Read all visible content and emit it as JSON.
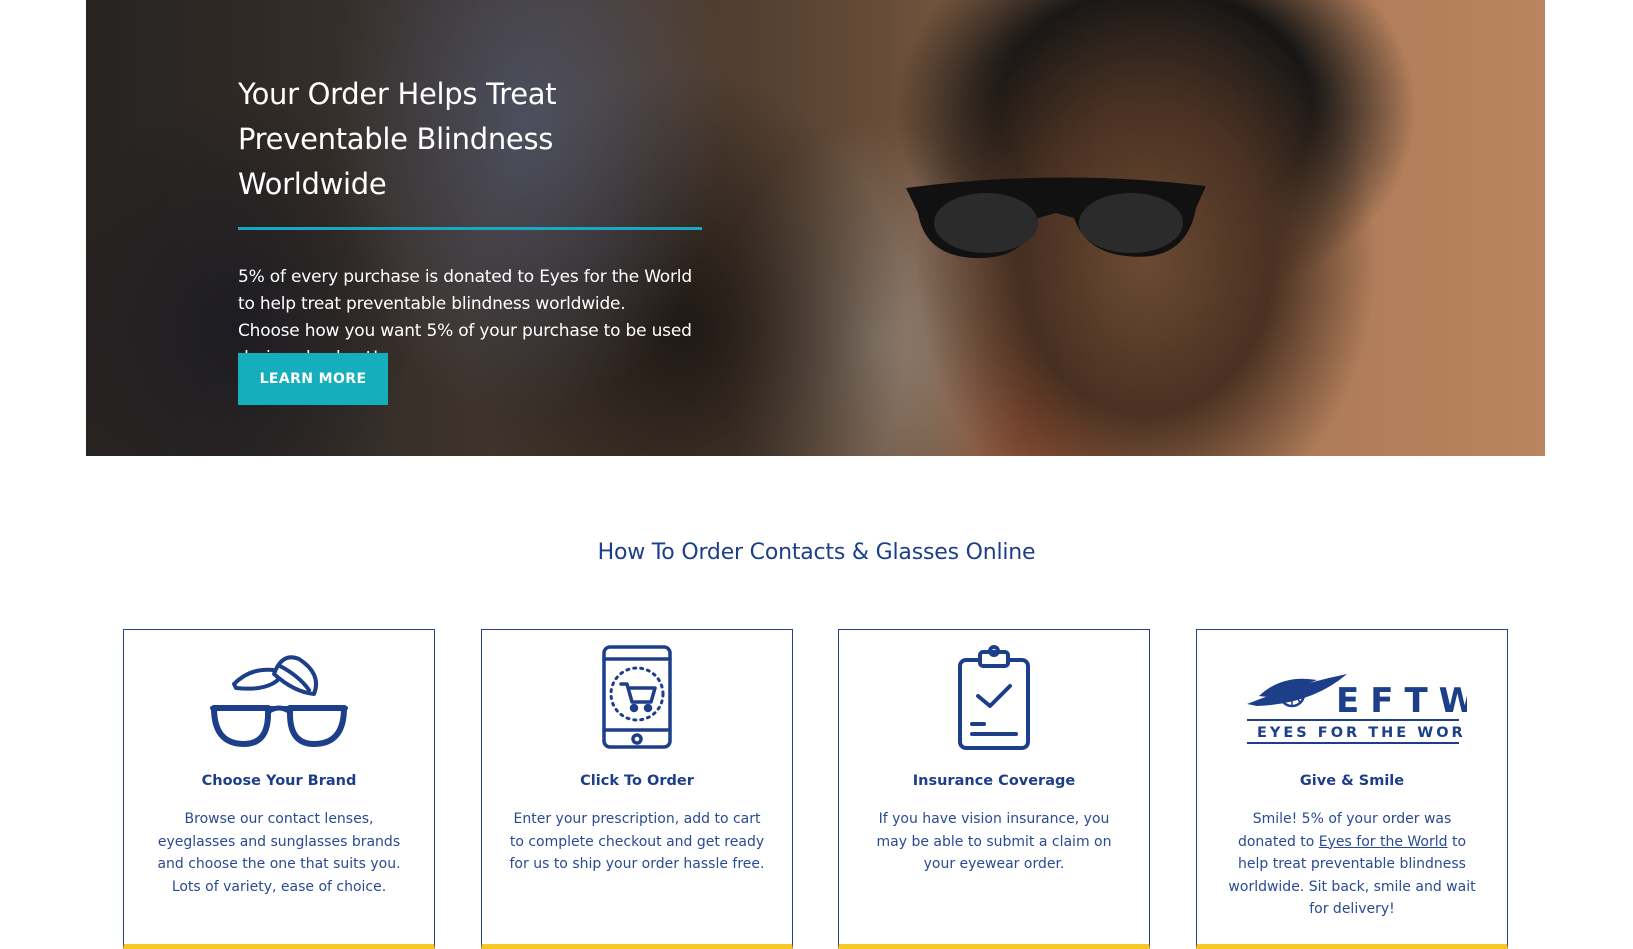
{
  "hero": {
    "title_line1": "Your Order Helps Treat",
    "title_line2": "Preventable Blindness Worldwide",
    "text_line1": "5% of every purchase is donated to Eyes for the World",
    "text_line2": "to help treat preventable blindness worldwide.",
    "text_line3": "Choose how you want 5% of your purchase to be used",
    "text_line4": "during checkout!",
    "button_label": "LEARN MORE"
  },
  "how_to": {
    "title": "How To Order Contacts & Glasses Online",
    "cards": [
      {
        "icon": "glasses-contacts-icon",
        "title": "Choose Your Brand",
        "text": "Browse our contact lenses, eyeglasses and sunglasses brands and choose the one that suits you. Lots of variety, ease of choice."
      },
      {
        "icon": "mobile-cart-icon",
        "title": "Click To Order",
        "text": "Enter your prescription, add to cart to complete checkout and get ready for us to ship your order hassle free."
      },
      {
        "icon": "clipboard-check-icon",
        "title": "Insurance Coverage",
        "text": "If you have vision insurance, you may be able to submit a claim on your eyewear order."
      },
      {
        "icon": "eftw-logo",
        "title": "Give & Smile",
        "text_before": "Smile! 5% of your order was donated to",
        "link_text": "Eyes for the World",
        "text_after": "to help treat preventable blindness worldwide. Sit back, smile and wait for delivery!",
        "logo_big": "EFTW",
        "logo_small": "EYES FOR THE WORLD"
      }
    ]
  },
  "colors": {
    "accent_teal": "#15aebd",
    "brand_blue": "#1d3f8a",
    "card_bottom_yellow": "#f5c922"
  }
}
